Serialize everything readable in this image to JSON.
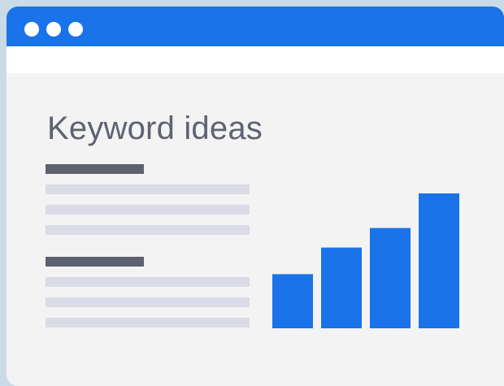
{
  "main": {
    "heading": "Keyword ideas"
  },
  "colors": {
    "accent": "#1a73e8",
    "background": "#c9dbe7",
    "window": "#f3f3f3",
    "text": "#5f6270"
  },
  "icons": [
    "window-dot-icon",
    "window-dot-icon",
    "window-dot-icon"
  ],
  "chart_data": {
    "type": "bar",
    "categories": [
      "",
      "",
      "",
      ""
    ],
    "values": [
      61,
      91,
      113,
      152
    ],
    "title": "",
    "xlabel": "",
    "ylabel": "",
    "ylim": [
      0,
      152
    ],
    "grid": false,
    "legend": "none"
  }
}
